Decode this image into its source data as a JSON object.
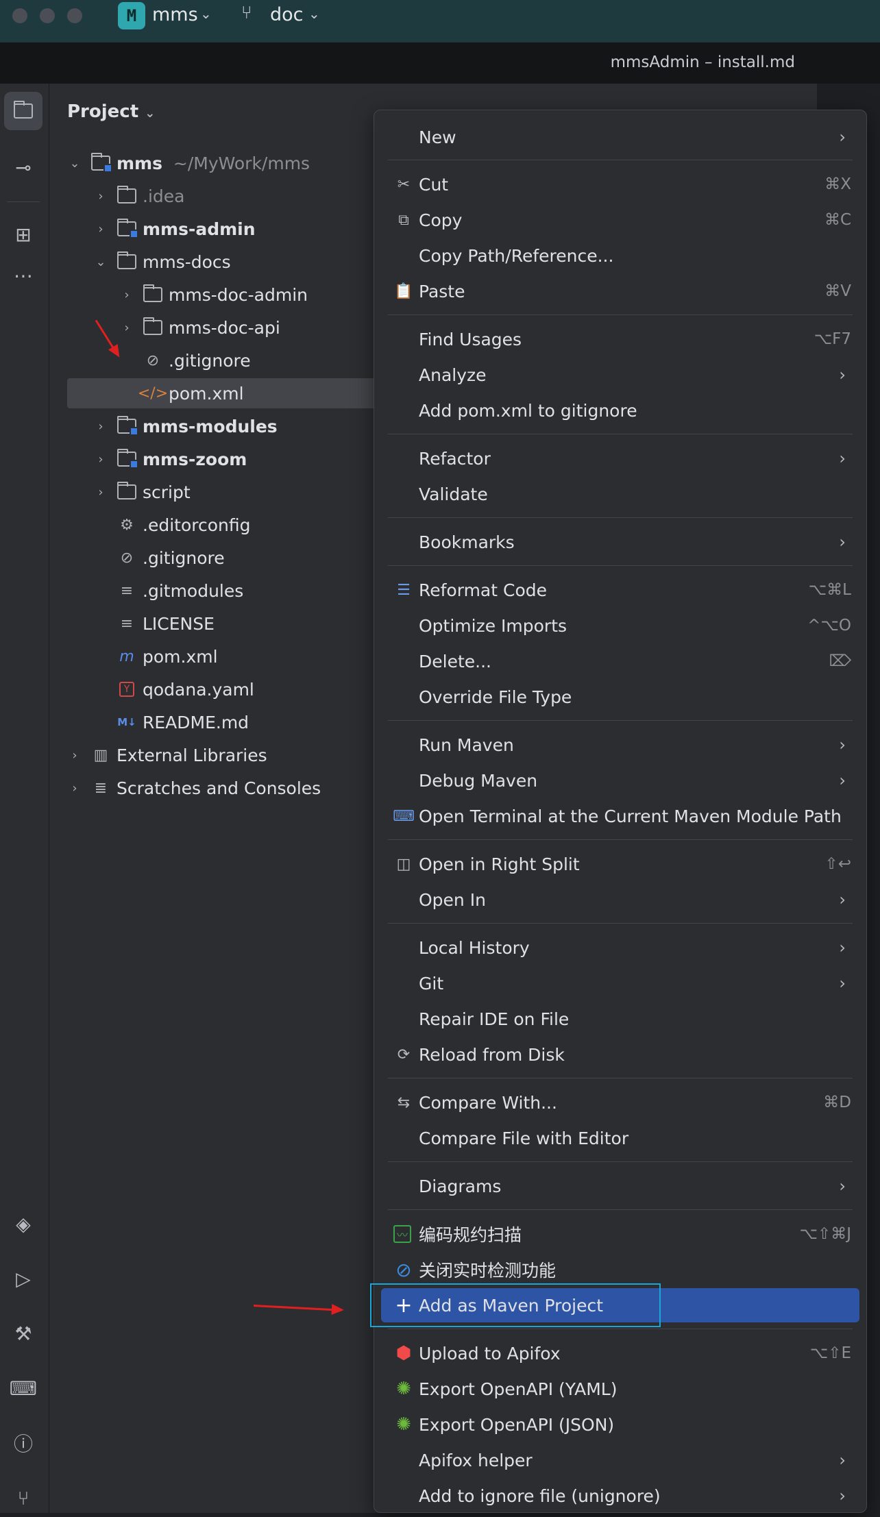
{
  "titlebar": {
    "project_badge": "M",
    "project_name": "mms",
    "branch_name": "doc"
  },
  "window_title": "mmsAdmin – install.md",
  "panel": {
    "title": "Project"
  },
  "tree": [
    {
      "name": "mms",
      "path": "~/MyWork/mms"
    },
    {
      "name": ".idea"
    },
    {
      "name": "mms-admin"
    },
    {
      "name": "mms-docs"
    },
    {
      "name": "mms-doc-admin"
    },
    {
      "name": "mms-doc-api"
    },
    {
      "name": ".gitignore"
    },
    {
      "name": "pom.xml"
    },
    {
      "name": "mms-modules"
    },
    {
      "name": "mms-zoom"
    },
    {
      "name": "script"
    },
    {
      "name": ".editorconfig"
    },
    {
      "name": ".gitignore"
    },
    {
      "name": ".gitmodules"
    },
    {
      "name": "LICENSE"
    },
    {
      "name": "pom.xml"
    },
    {
      "name": "qodana.yaml"
    },
    {
      "name": "README.md"
    },
    {
      "name": "External Libraries"
    },
    {
      "name": "Scratches and Consoles"
    }
  ],
  "menu": [
    {
      "label": "New",
      "shortcut": ""
    },
    {
      "label": "Cut",
      "shortcut": "⌘X"
    },
    {
      "label": "Copy",
      "shortcut": "⌘C"
    },
    {
      "label": "Copy Path/Reference...",
      "shortcut": ""
    },
    {
      "label": "Paste",
      "shortcut": "⌘V"
    },
    {
      "label": "Find Usages",
      "shortcut": "⌥F7"
    },
    {
      "label": "Analyze",
      "shortcut": ""
    },
    {
      "label": "Add pom.xml to gitignore",
      "shortcut": ""
    },
    {
      "label": "Refactor",
      "shortcut": ""
    },
    {
      "label": "Validate",
      "shortcut": ""
    },
    {
      "label": "Bookmarks",
      "shortcut": ""
    },
    {
      "label": "Reformat Code",
      "shortcut": "⌥⌘L"
    },
    {
      "label": "Optimize Imports",
      "shortcut": "^⌥O"
    },
    {
      "label": "Delete...",
      "shortcut": "⌦"
    },
    {
      "label": "Override File Type",
      "shortcut": ""
    },
    {
      "label": "Run Maven",
      "shortcut": ""
    },
    {
      "label": "Debug Maven",
      "shortcut": ""
    },
    {
      "label": "Open Terminal at the Current Maven Module Path",
      "shortcut": ""
    },
    {
      "label": "Open in Right Split",
      "shortcut": "⇧↩"
    },
    {
      "label": "Open In",
      "shortcut": ""
    },
    {
      "label": "Local History",
      "shortcut": ""
    },
    {
      "label": "Git",
      "shortcut": ""
    },
    {
      "label": "Repair IDE on File",
      "shortcut": ""
    },
    {
      "label": "Reload from Disk",
      "shortcut": ""
    },
    {
      "label": "Compare With...",
      "shortcut": "⌘D"
    },
    {
      "label": "Compare File with Editor",
      "shortcut": ""
    },
    {
      "label": "Diagrams",
      "shortcut": ""
    },
    {
      "label": "编码规约扫描",
      "shortcut": "⌥⇧⌘J"
    },
    {
      "label": "关闭实时检测功能",
      "shortcut": ""
    },
    {
      "label": "Add as Maven Project",
      "shortcut": ""
    },
    {
      "label": "Upload to Apifox",
      "shortcut": "⌥⇧E"
    },
    {
      "label": "Export OpenAPI (YAML)",
      "shortcut": ""
    },
    {
      "label": "Export OpenAPI (JSON)",
      "shortcut": ""
    },
    {
      "label": "Apifox helper",
      "shortcut": ""
    },
    {
      "label": "Add to ignore file (unignore)",
      "shortcut": ""
    }
  ],
  "colors": {
    "highlight": "#2e55a5",
    "focus_outline": "#1aa7d8",
    "annotation_arrow": "#e02020"
  }
}
